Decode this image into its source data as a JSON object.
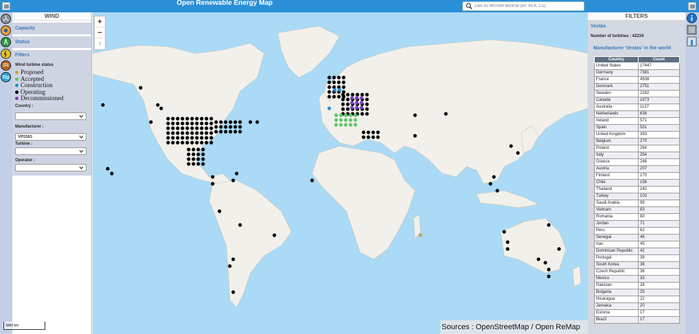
{
  "app": {
    "title": "Open Renewable Energy Map",
    "search_placeholder": "Lieu ou WGS84 décimal (ex: 45.6, 2.5)"
  },
  "left_panel": {
    "title": "WIND",
    "sections": [
      "Capacity",
      "Status"
    ],
    "filters_title": "Filters",
    "status_title": "Wind turbine status",
    "statuses": [
      {
        "label": "Proposed",
        "color": "#c8a83a"
      },
      {
        "label": "Accepted",
        "color": "#5ec46e"
      },
      {
        "label": "Construction",
        "color": "#2a8fd6"
      },
      {
        "label": "Operating",
        "color": "#000000"
      },
      {
        "label": "Decommissioned",
        "color": "#7b3fc4"
      }
    ],
    "country_label": "Country :",
    "country_value": "",
    "manufacturer_label": "Manufacturer :",
    "manufacturer_value": "Vestas",
    "turbine_label": "Turbine :",
    "turbine_value": "",
    "operator_label": "Operator :",
    "operator_value": ""
  },
  "map": {
    "zoom_in": "+",
    "zoom_out": "−",
    "reset_north": "↑",
    "attribution": "Sources : OpenStreetMap / Open ReMap",
    "scale_label": "3000 km",
    "marker_color": "#000000"
  },
  "right_panel": {
    "title": "FILTERS",
    "manufacturer_name": "Vestas",
    "turbine_count_text": "Number of turbines : 42234",
    "world_title": "Manufacturer 'Vestas' in the world",
    "table_headers": [
      "Country",
      "Count"
    ],
    "table_rows": [
      [
        "United States",
        "17447"
      ],
      [
        "Germany",
        "7381"
      ],
      [
        "France",
        "4508"
      ],
      [
        "Denmark",
        "2751"
      ],
      [
        "Sweden",
        "2282"
      ],
      [
        "Canada",
        "1873"
      ],
      [
        "Australia",
        "1137"
      ],
      [
        "Netherlands",
        "638"
      ],
      [
        "Ireland",
        "571"
      ],
      [
        "Spain",
        "531"
      ],
      [
        "United Kingdom",
        "393"
      ],
      [
        "Belgium",
        "270"
      ],
      [
        "Poland",
        "264"
      ],
      [
        "Italy",
        "254"
      ],
      [
        "Greece",
        "248"
      ],
      [
        "Austria",
        "207"
      ],
      [
        "Finland",
        "170"
      ],
      [
        "Chile",
        "158"
      ],
      [
        "Thailand",
        "142"
      ],
      [
        "Turkey",
        "103"
      ],
      [
        "Saudi Arabia",
        "99"
      ],
      [
        "Vietnam",
        "83"
      ],
      [
        "Romania",
        "80"
      ],
      [
        "Jordan",
        "71"
      ],
      [
        "Peru",
        "62"
      ],
      [
        "Senegal",
        "46"
      ],
      [
        "Iran",
        "45"
      ],
      [
        "Dominican Republic",
        "42"
      ],
      [
        "Portugal",
        "39"
      ],
      [
        "South Korea",
        "36"
      ],
      [
        "Czech Republic",
        "36"
      ],
      [
        "Mexico",
        "33"
      ],
      [
        "Pakistan",
        "28"
      ],
      [
        "Bulgaria",
        "25"
      ],
      [
        "Nicaragua",
        "22"
      ],
      [
        "Jamaica",
        "20"
      ],
      [
        "Estonia",
        "17"
      ],
      [
        "Brazil",
        "17"
      ]
    ]
  }
}
